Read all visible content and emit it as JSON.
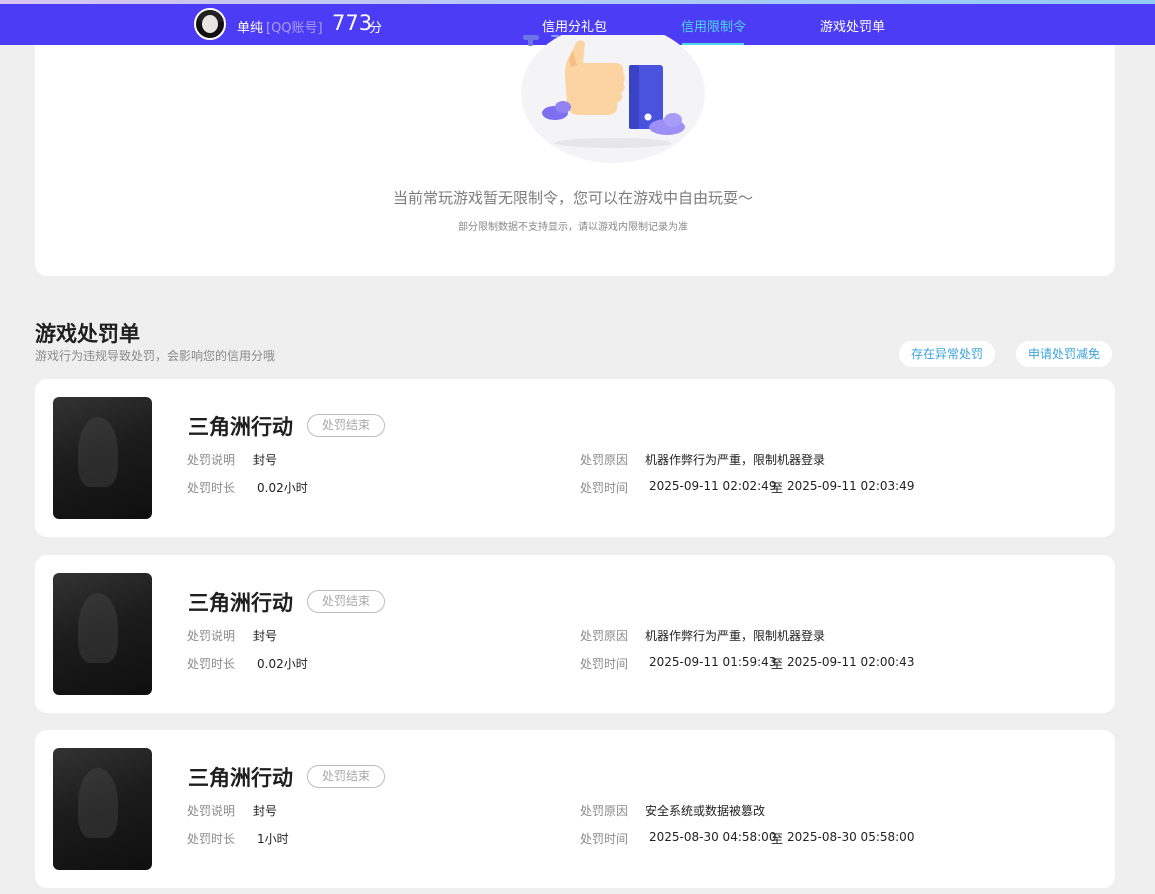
{
  "header": {
    "user_name": "单纯",
    "account_type": "[QQ账号]",
    "score": "773",
    "score_unit": "分",
    "tabs": [
      {
        "label": "信用分礼包"
      },
      {
        "label": "信用限制令"
      },
      {
        "label": "游戏处罚单"
      }
    ]
  },
  "restriction": {
    "empty_text": "当前常玩游戏暂无限制令，您可以在游戏中自由玩耍～",
    "note": "部分限制数据不支持显示，请以游戏内限制记录为准"
  },
  "penalty": {
    "title": "游戏处罚单",
    "subtitle": "游戏行为违规导致处罚，会影响您的信用分哦",
    "btn_abnormal": "存在异常处罚",
    "btn_apply": "申请处罚减免",
    "labels": {
      "desc": "处罚说明",
      "duration": "处罚时长",
      "reason": "处罚原因",
      "time": "处罚时间",
      "to": "至"
    },
    "items": [
      {
        "game": "三角洲行动",
        "status": "处罚结束",
        "desc": "封号",
        "duration": "0.02小时",
        "reason": "机器作弊行为严重，限制机器登录",
        "start": "2025-09-11 02:02:49",
        "end": "2025-09-11 02:03:49"
      },
      {
        "game": "三角洲行动",
        "status": "处罚结束",
        "desc": "封号",
        "duration": "0.02小时",
        "reason": "机器作弊行为严重，限制机器登录",
        "start": "2025-09-11 01:59:43",
        "end": "2025-09-11 02:00:43"
      },
      {
        "game": "三角洲行动",
        "status": "处罚结束",
        "desc": "封号",
        "duration": "1小时",
        "reason": "安全系统或数据被篡改",
        "start": "2025-08-30 04:58:00",
        "end": "2025-08-30 05:58:00"
      }
    ]
  },
  "colors": {
    "navbar": "#4c3cf6",
    "tab_active": "#4fd6f0",
    "pill_text": "#3aa4df",
    "page_bg": "#efefef"
  }
}
